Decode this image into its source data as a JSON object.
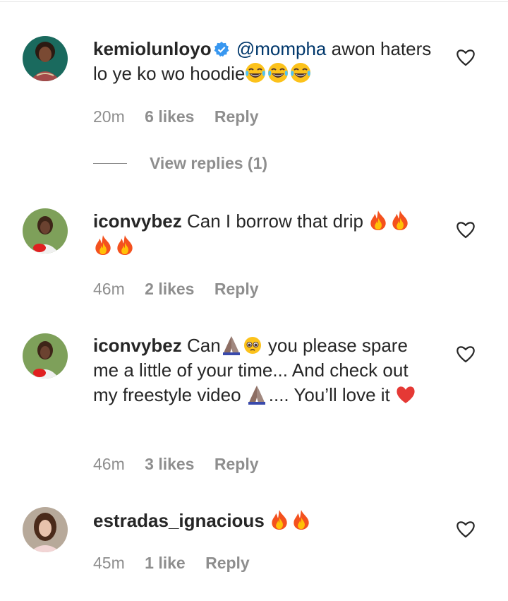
{
  "comments": [
    {
      "username": "kemiolunloyo",
      "verified": true,
      "mention": "@mompha",
      "text_before": "awon haters lo ye ko wo hoodie",
      "emojis": "😂😂😂",
      "time": "20m",
      "likes": "6 likes",
      "reply": "Reply",
      "view_replies": "View replies (1)"
    },
    {
      "username": "iconvybez",
      "text": "Can I borrow that drip",
      "emojis": "🔥🔥🔥🔥",
      "time": "46m",
      "likes": "2 likes",
      "reply": "Reply"
    },
    {
      "username": "iconvybez",
      "text_part1": "Can",
      "text_part2": "you please spare me a little of your time... And check out my freestyle video",
      "text_part3": ".... You’ll love it",
      "time": "46m",
      "likes": "3 likes",
      "reply": "Reply"
    },
    {
      "username": "estradas_ignacious",
      "emojis": "🔥🔥",
      "time": "45m",
      "likes": "1 like",
      "reply": "Reply"
    }
  ],
  "icons": {
    "verified": "verified-badge-icon",
    "like": "heart-outline-icon"
  },
  "colors": {
    "verified_blue": "#3897f0",
    "mention": "#00376b",
    "meta_gray": "#8e8e8e",
    "text": "#262626"
  }
}
